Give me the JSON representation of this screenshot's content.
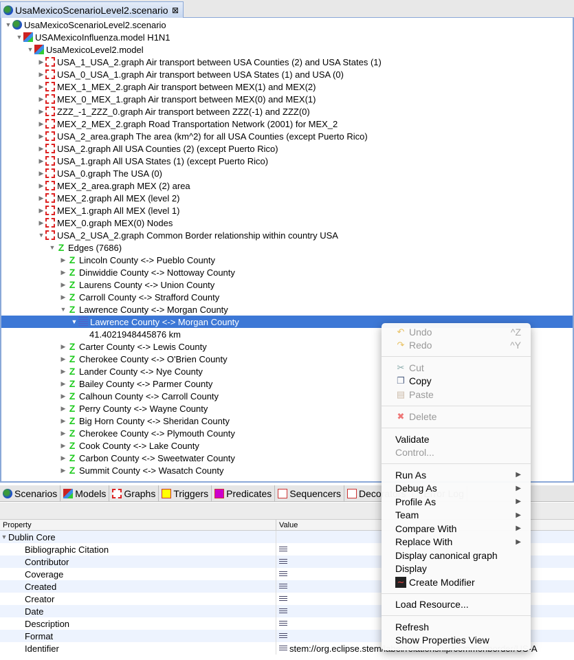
{
  "editor_tab": {
    "title": "UsaMexicoScenarioLevel2.scenario",
    "close": "⊠"
  },
  "tree": {
    "scenario": "UsaMexicoScenarioLevel2.scenario",
    "model": "USAMexicoInfluenza.model H1N1",
    "submodel": "UsaMexicoLevel2.model",
    "graphs": [
      "USA_1_USA_2.graph Air transport between USA Counties (2) and USA States (1)",
      "USA_0_USA_1.graph Air transport between USA States (1) and USA (0)",
      "MEX_1_MEX_2.graph Air transport between MEX(1) and MEX(2)",
      "MEX_0_MEX_1.graph Air transport between MEX(0) and MEX(1)",
      "ZZZ_-1_ZZZ_0.graph Air transport between ZZZ(-1) and ZZZ(0)",
      "MEX_2_MEX_2.graph Road Transportation Network (2001) for MEX_2",
      "USA_2_area.graph The area (km^2) for all USA Counties (except Puerto Rico)",
      "USA_2.graph All USA Counties (2) (except Puerto Rico)",
      "USA_1.graph All USA States (1) (except Puerto Rico)",
      "USA_0.graph The USA (0)",
      "MEX_2_area.graph MEX (2) area",
      "MEX_2.graph All MEX (level 2)",
      "MEX_1.graph All MEX (level 1)",
      "MEX_0.graph MEX(0) Nodes",
      "USA_2_USA_2.graph Common Border relationship within country USA"
    ],
    "edges_label": "Edges (7686)",
    "edges_before": [
      "Lincoln County <-> Pueblo County",
      "Dinwiddie County <-> Nottoway County",
      "Laurens County <-> Union County",
      "Carroll County <-> Strafford County"
    ],
    "expanded_edge": "Lawrence County <-> Morgan County",
    "selected_child": "Lawrence County <-> Morgan County",
    "selected_value": "41.4021948445876 km",
    "edges_after": [
      "Carter County <-> Lewis County",
      "Cherokee County <-> O'Brien County",
      "Lander County <-> Nye County",
      "Bailey County <-> Parmer County",
      "Calhoun County <-> Carroll County",
      "Perry County <-> Wayne County",
      "Big Horn County <-> Sheridan County",
      "Cherokee County <-> Plymouth County",
      "Cook County <-> Lake County",
      "Carbon County <-> Sweetwater County",
      "Summit County <-> Wasatch County"
    ]
  },
  "view_tabs": [
    "Scenarios",
    "Models",
    "Graphs",
    "Triggers",
    "Predicates",
    "Sequencers",
    "Decorators",
    "Error Log"
  ],
  "properties": {
    "col_property": "Property",
    "col_value": "Value",
    "group": "Dublin Core",
    "rows": [
      {
        "name": "Bibliographic Citation",
        "value": ""
      },
      {
        "name": "Contributor",
        "value": ""
      },
      {
        "name": "Coverage",
        "value": ""
      },
      {
        "name": "Created",
        "value": ""
      },
      {
        "name": "Creator",
        "value": ""
      },
      {
        "name": "Date",
        "value": ""
      },
      {
        "name": "Description",
        "value": ""
      },
      {
        "name": "Format",
        "value": ""
      },
      {
        "name": "Identifier",
        "value": "stem://org.eclipse.stem/label/relationship/commonborder/US-A"
      }
    ]
  },
  "menu": {
    "undo": "Undo",
    "undo_sc": "^Z",
    "redo": "Redo",
    "redo_sc": "^Y",
    "cut": "Cut",
    "copy": "Copy",
    "paste": "Paste",
    "delete": "Delete",
    "validate": "Validate",
    "control": "Control...",
    "run_as": "Run As",
    "debug_as": "Debug As",
    "profile_as": "Profile As",
    "team": "Team",
    "compare_with": "Compare With",
    "replace_with": "Replace With",
    "display_canonical": "Display canonical graph",
    "display": "Display",
    "create_modifier": "Create Modifier",
    "load_resource": "Load Resource...",
    "refresh": "Refresh",
    "show_properties": "Show Properties View"
  }
}
